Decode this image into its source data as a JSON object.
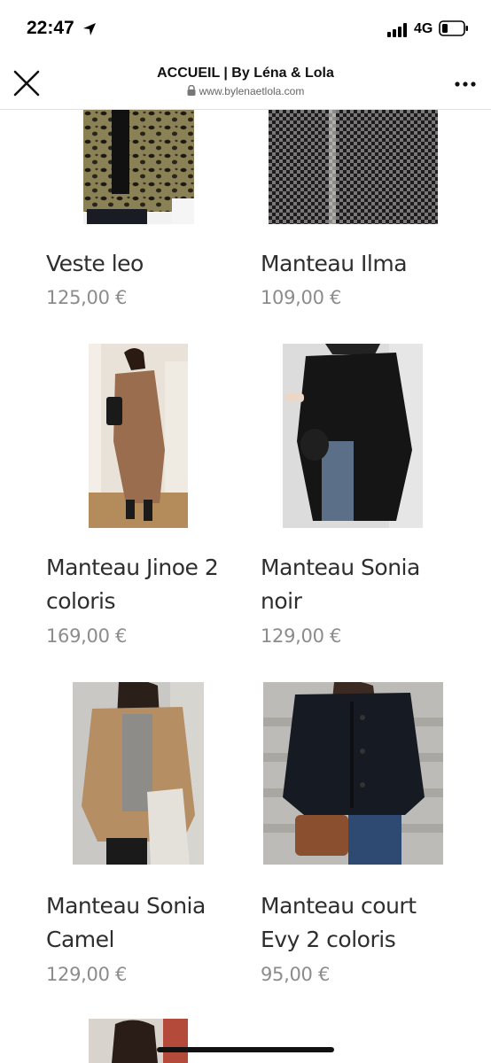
{
  "status": {
    "time": "22:47",
    "network": "4G"
  },
  "browser": {
    "title": "ACCUEIL | By Léna & Lola",
    "url": "www.bylenaetlola.com"
  },
  "products": [
    {
      "name": "Veste leo",
      "price": "125,00 €"
    },
    {
      "name": "Manteau Ilma",
      "price": "109,00 €"
    },
    {
      "name": "Manteau Jinoe 2 coloris",
      "price": "169,00 €"
    },
    {
      "name": "Manteau Sonia noir",
      "price": "129,00 €"
    },
    {
      "name": "Manteau Sonia Camel",
      "price": "129,00 €"
    },
    {
      "name": "Manteau court Evy 2 coloris",
      "price": "95,00 €"
    }
  ]
}
